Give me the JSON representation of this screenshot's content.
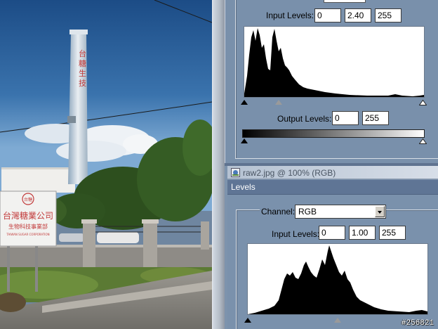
{
  "colors": {
    "sky_top": "#1d4f8a",
    "sky_bottom": "#6fa0cc",
    "dialog_bg": "#7990ab",
    "levels_bar": "#5f7595",
    "title_bar": "#c2cdda",
    "field_bg": "#ffffff"
  },
  "photo": {
    "sign_line1": "台灣糖業公司",
    "sign_line2": "生物科技事業部",
    "sign_line3": "TAIWAN SUGAR CORPORATION",
    "chimney_text": "台糖生技"
  },
  "top_dialog": {
    "input_levels_label": "Input Levels:",
    "input_black": "0",
    "input_gamma": "2.40",
    "input_white": "255",
    "output_levels_label": "Output Levels:",
    "output_black": "0",
    "output_white": "255"
  },
  "window2": {
    "title": "raw2.jpg @ 100% (RGB)",
    "panel_title": "Levels",
    "channel_label": "Channel:",
    "channel_value": "RGB",
    "input_levels_label": "Input Levels:",
    "input_black": "0",
    "input_gamma": "1.00",
    "input_white": "255"
  },
  "watermark": "#256821",
  "icons": [
    "document-icon",
    "dropdown-arrow-icon",
    "black-point-slider-icon",
    "gamma-slider-icon",
    "white-point-slider-icon"
  ]
}
